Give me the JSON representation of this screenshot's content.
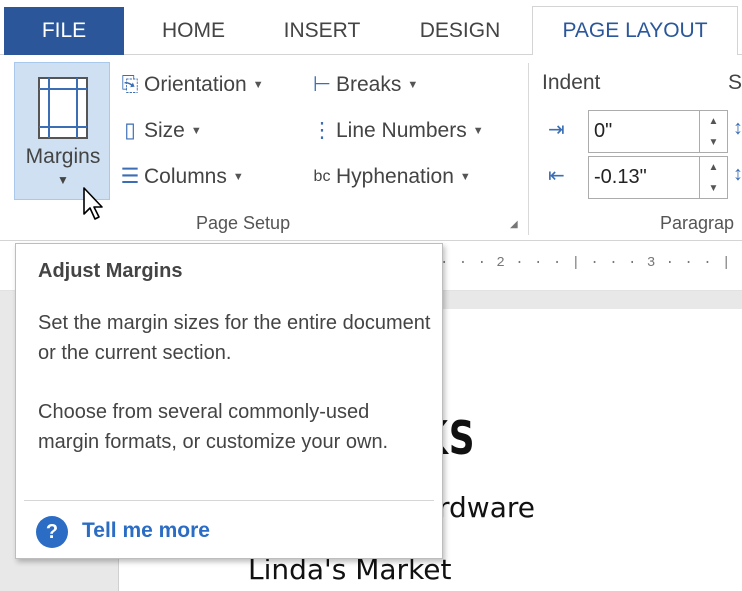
{
  "tabs": {
    "file": "FILE",
    "home": "HOME",
    "insert": "INSERT",
    "design": "DESIGN",
    "page_layout": "PAGE LAYOUT"
  },
  "page_setup": {
    "margins_label": "Margins",
    "orientation": "Orientation",
    "size": "Size",
    "columns": "Columns",
    "breaks": "Breaks",
    "line_numbers": "Line Numbers",
    "hyphenation": "Hyphenation",
    "group_label": "Page Setup"
  },
  "paragraph": {
    "indent_label": "Indent",
    "spacing_label_partial": "S",
    "indent_left_value": "0\"",
    "indent_right_value": "-0.13\"",
    "group_label_partial": "Paragrap"
  },
  "ruler": {
    "text": "· · · 2 · · · | · · · 3 · · · | ·"
  },
  "tooltip": {
    "title": "Adjust Margins",
    "para1": "Set the margin sizes for the entire document or the current section.",
    "para2": "Choose from several commonly-used margin formats, or customize your own.",
    "link": "Tell me more"
  },
  "document": {
    "title_partial": "HANKS",
    "line1_partial": "rdware",
    "line2": "Linda's Market"
  },
  "colors": {
    "accent": "#2b579a",
    "selected_button": "#cfe0f2",
    "link": "#2b6cc4"
  }
}
